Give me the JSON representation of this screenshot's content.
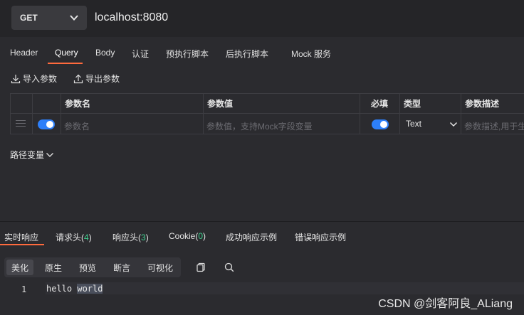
{
  "request": {
    "method": "GET",
    "url": "localhost:8080"
  },
  "request_tabs": [
    "Header",
    "Query",
    "Body",
    "认证",
    "预执行脚本",
    "后执行脚本",
    "Mock 服务"
  ],
  "active_request_tab": "Query",
  "toolbar": {
    "import_label": "导入参数",
    "export_label": "导出参数"
  },
  "params_table": {
    "headers": {
      "name": "参数名",
      "value": "参数值",
      "required": "必填",
      "type": "类型",
      "description": "参数描述"
    },
    "row": {
      "enabled": true,
      "name_placeholder": "参数名",
      "value_placeholder": "参数值，支持Mock字段变量",
      "required": true,
      "type": "Text",
      "description_placeholder": "参数描述,用于生"
    }
  },
  "path_variables_label": "路径变量",
  "response_tabs": {
    "realtime": "实时响应",
    "req_headers": "请求头(",
    "req_headers_count": "4",
    "resp_headers": "响应头(",
    "resp_headers_count": "3",
    "cookie": "Cookie(",
    "cookie_count": "0",
    "close_paren": ")",
    "success_example": "成功响应示例",
    "error_example": "错误响应示例"
  },
  "view_modes": [
    "美化",
    "原生",
    "预览",
    "断言",
    "可视化"
  ],
  "active_view_mode": "美化",
  "response_body": {
    "line_number": "1",
    "text_before": "hello ",
    "text_selected": "world"
  },
  "watermark": "CSDN @剑客阿良_ALiang",
  "colors": {
    "accent": "#ff6a3d",
    "toggle": "#2d7ff9",
    "count": "#3ecf8e"
  }
}
